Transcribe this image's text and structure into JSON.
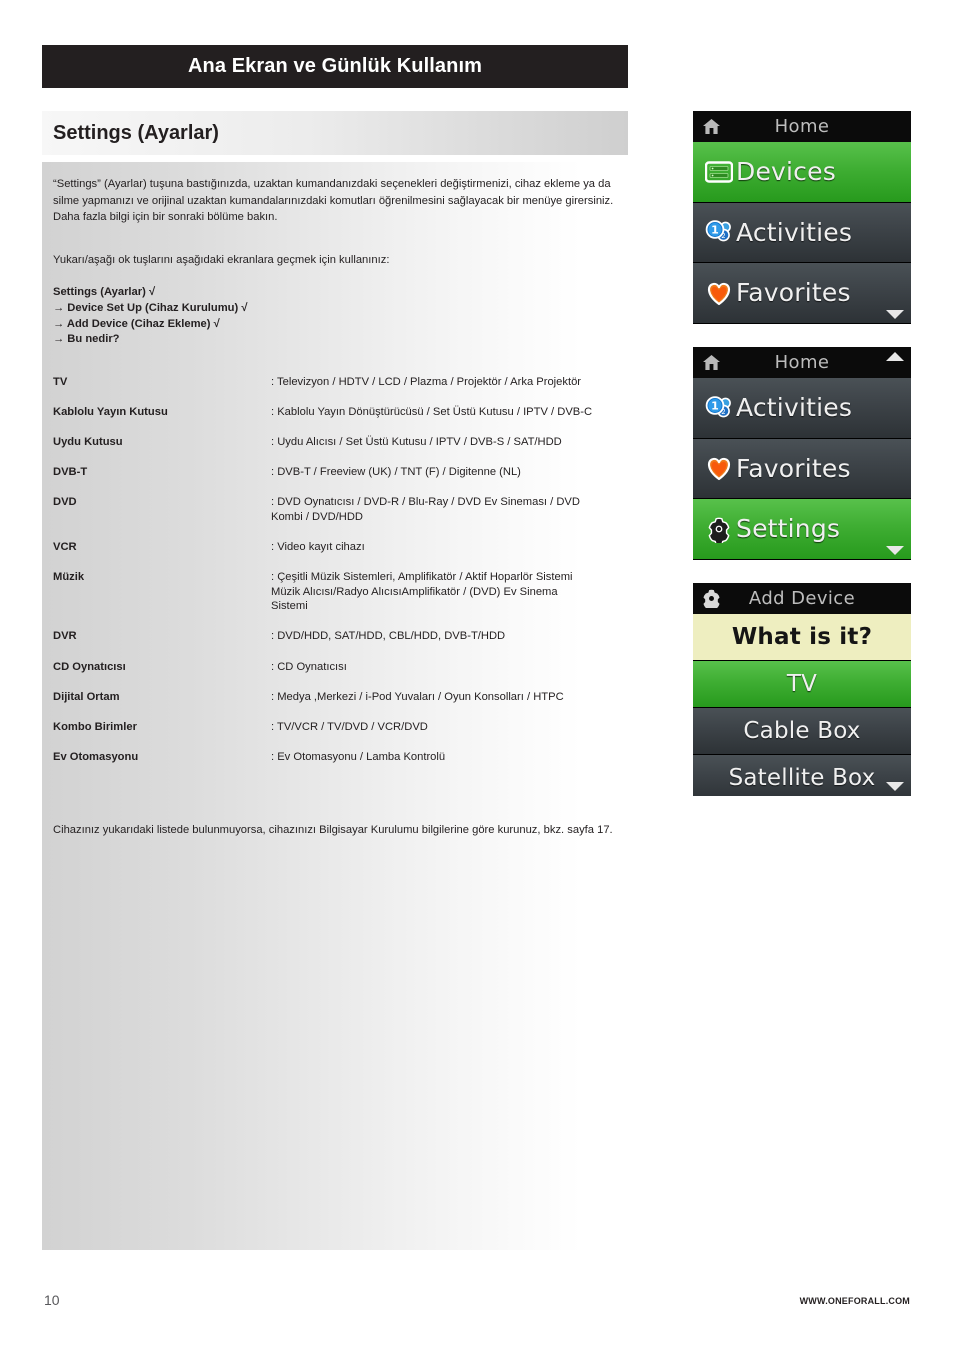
{
  "page": {
    "chapter_title": "Ana Ekran ve Günlük Kullanım",
    "section_title": "Settings (Ayarlar)",
    "intro_paragraph": "“Settings” (Ayarlar) tuşuna bastığınızda, uzaktan kumandanızdaki seçenekleri değiştirmenizi, cihaz ekleme ya da silme yapmanızı ve orijinal uzaktan kumandalarınızdaki komutları öğrenilmesini sağlayacak bir menüye girersiniz. Daha fazla bilgi için bir sonraki bölüme bakın.",
    "arrows_instruction": "Yukarı/aşağı ok tuşlarını aşağıdaki ekranlara geçmek için kullanınız:",
    "nav_path": [
      "Settings (Ayarlar)  √",
      "→ Device Set Up (Cihaz Kurulumu) √",
      "→ Add Device (Cihaz Ekleme) √",
      "→ Bu nedir?"
    ],
    "footnote": "Cihazınız yukarıdaki listede bulunmuyorsa, cihazınızı Bilgisayar Kurulumu bilgilerine göre kurunuz, bkz. sayfa 17.",
    "page_number": "10",
    "website": "WWW.ONEFORALL.COM"
  },
  "device_table": {
    "rows": [
      {
        "name": "TV",
        "desc": ": Televizyon / HDTV / LCD / Plazma / Projektör / Arka Projektör"
      },
      {
        "name": "Kablolu Yayın Kutusu",
        "desc": ": Kablolu Yayın Dönüştürücüsü / Set Üstü Kutusu / IPTV / DVB-C"
      },
      {
        "name": "Uydu Kutusu",
        "desc": ": Uydu Alıcısı / Set Üstü Kutusu / IPTV / DVB-S / SAT/HDD"
      },
      {
        "name": "DVB-T",
        "desc": ": DVB-T / Freeview (UK) / TNT (F) / Digitenne (NL)"
      },
      {
        "name": "DVD",
        "desc": ": DVD Oynatıcısı / DVD-R / Blu-Ray / DVD Ev Sineması / DVD Kombi / DVD/HDD"
      },
      {
        "name": "VCR",
        "desc": ": Video kayıt cihazı"
      },
      {
        "name": "Müzik",
        "desc": ": Çeşitli Müzik Sistemleri, Amplifikatör / Aktif Hoparlör Sistemi Müzik Alıcısı/Radyo AlıcısıAmplifikatör / (DVD) Ev Sinema Sistemi"
      },
      {
        "name": "DVR",
        "desc": ": DVD/HDD, SAT/HDD, CBL/HDD, DVB-T/HDD"
      },
      {
        "name": "CD Oynatıcısı",
        "desc": ": CD Oynatıcısı"
      },
      {
        "name": "Dijital Ortam",
        "desc": ": Medya ,Merkezi / i-Pod Yuvaları / Oyun Konsolları / HTPC"
      },
      {
        "name": "Kombo Birimler",
        "desc": ": TV/VCR / TV/DVD / VCR/DVD"
      },
      {
        "name": "Ev Otomasyonu",
        "desc": ": Ev Otomasyonu / Lamba Kontrolü"
      }
    ]
  },
  "screens": [
    {
      "header_title": "Home",
      "header_icon": "home-icon",
      "scroll_down": true,
      "scroll_up": false,
      "items": [
        {
          "label": "Devices",
          "icon": "devices-icon",
          "state": "selected"
        },
        {
          "label": "Activities",
          "icon": "activities-icon",
          "state": "normal"
        },
        {
          "label": "Favorites",
          "icon": "heart-icon",
          "state": "normal"
        }
      ]
    },
    {
      "header_title": "Home",
      "header_icon": "home-icon",
      "scroll_down": true,
      "scroll_up": true,
      "items": [
        {
          "label": "Activities",
          "icon": "activities-icon",
          "state": "normal"
        },
        {
          "label": "Favorites",
          "icon": "heart-icon",
          "state": "normal"
        },
        {
          "label": "Settings",
          "icon": "gear-icon",
          "state": "selected"
        }
      ]
    },
    {
      "header_title": "Add Device",
      "header_icon": "gear-icon",
      "scroll_down": true,
      "scroll_up": false,
      "items": [
        {
          "label": "What is it?",
          "icon": "",
          "state": "highlight"
        },
        {
          "label": "TV",
          "icon": "",
          "state": "selected"
        },
        {
          "label": "Cable Box",
          "icon": "",
          "state": "normal"
        },
        {
          "label": "Satellite Box",
          "icon": "",
          "state": "normal"
        }
      ]
    }
  ],
  "colors": {
    "title_bar": "#231f20",
    "selected_green": "#3fae33",
    "row_dark": "#3e4449",
    "highlight_cream": "#eeeec0",
    "header_black": "#0b0b0b"
  }
}
